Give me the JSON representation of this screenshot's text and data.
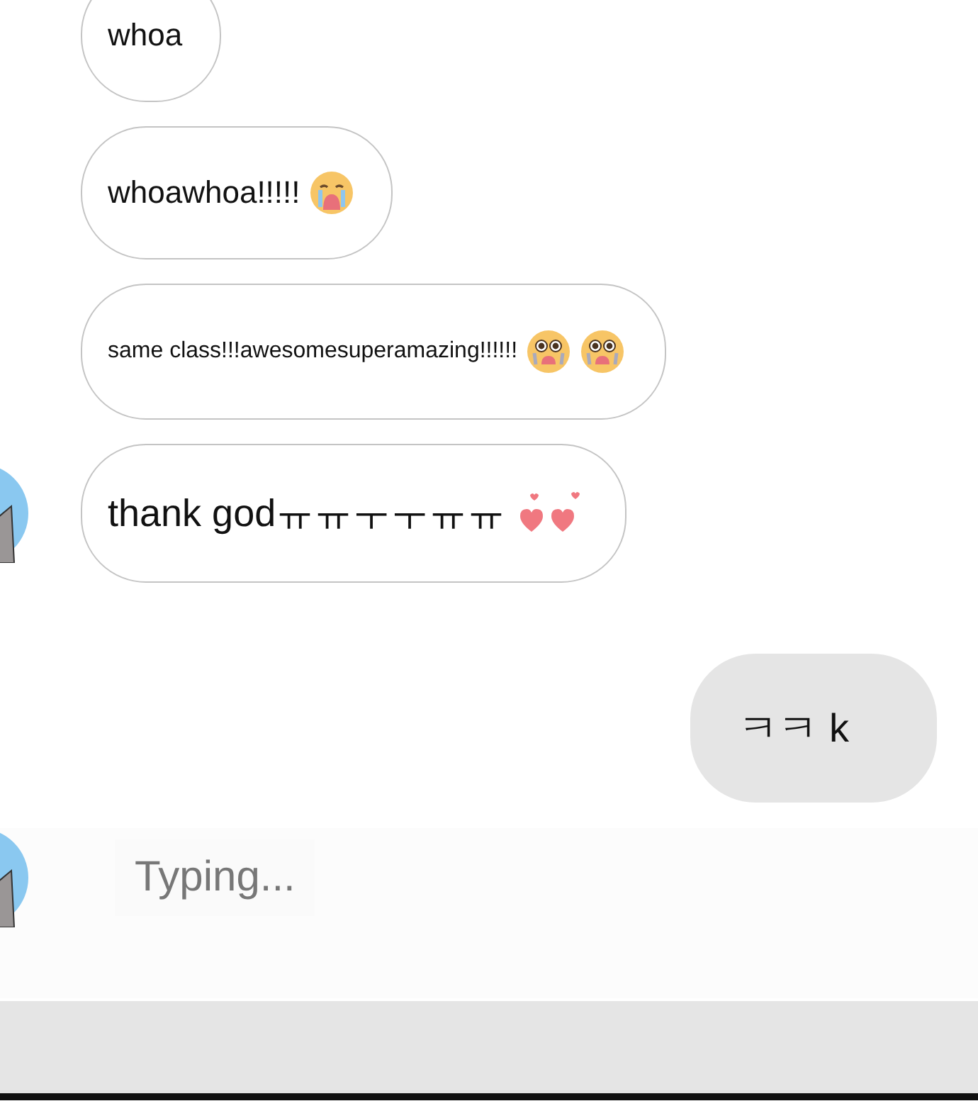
{
  "messages": [
    {
      "kind": "received",
      "text": "whoa",
      "avatar": false
    },
    {
      "kind": "received",
      "text": "whoawhoa!!!!!",
      "avatar": false,
      "emoji": [
        {
          "kind": "crying"
        }
      ]
    },
    {
      "kind": "received",
      "text": "same class!!!awesomesuperamazing!!!!!!",
      "avatar": false,
      "emoji": [
        {
          "kind": "pleading"
        },
        {
          "kind": "pleading"
        }
      ]
    },
    {
      "kind": "received",
      "text": "thank godㅠㅠㅜㅜㅠㅠ",
      "avatar": true,
      "emoji": [
        {
          "kind": "hearts"
        }
      ]
    },
    {
      "kind": "sent",
      "text": "ㅋㅋ k"
    }
  ],
  "typing": {
    "text": "Typing...",
    "avatar": true
  }
}
